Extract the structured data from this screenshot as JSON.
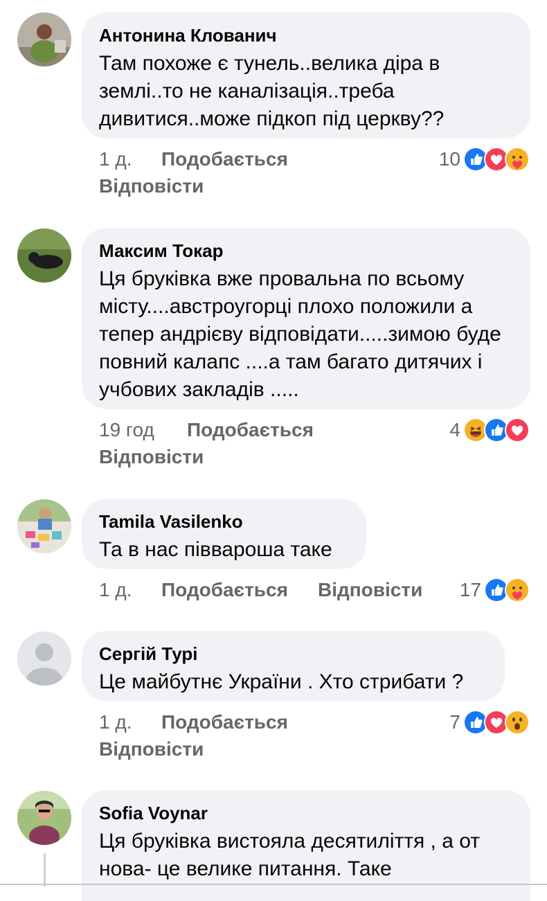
{
  "comments": [
    {
      "author": "Антонина Клованич",
      "text": "Там похоже є тунель..велика діра в землі..то не каналізація..треба дивитися..може підкоп під церкву??",
      "time": "1 д.",
      "like_label": "Подобається",
      "reply_label": "Відповісти",
      "reaction_count": "10",
      "reactions": [
        "like-icon",
        "love-icon",
        "care-icon"
      ]
    },
    {
      "author": "Максим Токар",
      "text": "Ця бруківка вже провальна по всьому місту....австроугорці плохо положили а тепер андрієву відповідати.....зимою буде повний калапс ....а там багато дитячих і учбових закладів .....",
      "time": "19 год",
      "like_label": "Подобається",
      "reply_label": "Відповісти",
      "reaction_count": "4",
      "reactions": [
        "haha-icon",
        "like-icon",
        "love-icon"
      ]
    },
    {
      "author": "Tamila  Vasilenko",
      "text": "Та в нас піввароша таке",
      "time": "1 д.",
      "like_label": "Подобається",
      "reply_label": "Відповісти",
      "reaction_count": "17",
      "reactions": [
        "like-icon",
        "care-icon"
      ]
    },
    {
      "author": "Сергій Турі",
      "text": "Це майбутнє України . Хто стрибати ?",
      "time": "1 д.",
      "like_label": "Подобається",
      "reply_label": "Відповісти",
      "reaction_count": "7",
      "reactions": [
        "like-icon",
        "love-icon",
        "wow-icon"
      ]
    },
    {
      "author": "Sofia  Voynar",
      "text": "Ця бруківка вистояла десятиліття , а от нова- це велике питання. Таке",
      "time": "",
      "like_label": "",
      "reply_label": "",
      "reaction_count": "",
      "reactions": []
    }
  ],
  "colors": {
    "bubble": "#f0f2f5",
    "meta_text": "#65676b",
    "like_blue": "#1877f2",
    "love_red": "#f33e58",
    "emoji_yellow": "#f7b125"
  }
}
